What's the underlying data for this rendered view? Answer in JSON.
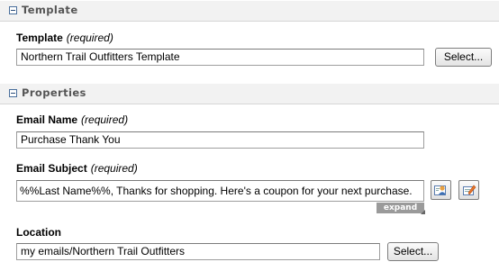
{
  "template_section": {
    "title": "Template",
    "template_label": "Template",
    "required_text": "(required)",
    "template_value": "Northern Trail Outfitters Template",
    "select_button": "Select..."
  },
  "properties_section": {
    "title": "Properties",
    "email_name_label": "Email Name",
    "email_name_required": "(required)",
    "email_name_value": "Purchase Thank You",
    "email_subject_label": "Email Subject",
    "email_subject_required": "(required)",
    "email_subject_value": "%%Last Name%%, Thanks for shopping. Here's a coupon for your next purchase.",
    "expand_label": "expand",
    "location_label": "Location",
    "location_value": "my emails/Northern Trail Outfitters",
    "location_select_button": "Select..."
  },
  "icons": {
    "personalization": "personalization-icon",
    "dynamic_content": "dynamic-subject-icon",
    "collapse": "collapse-icon"
  },
  "colors": {
    "header_bg": "#f2f2f2",
    "header_text": "#555555",
    "expand_bg": "#9a9a9a",
    "icon_accent": "#e8762b"
  }
}
